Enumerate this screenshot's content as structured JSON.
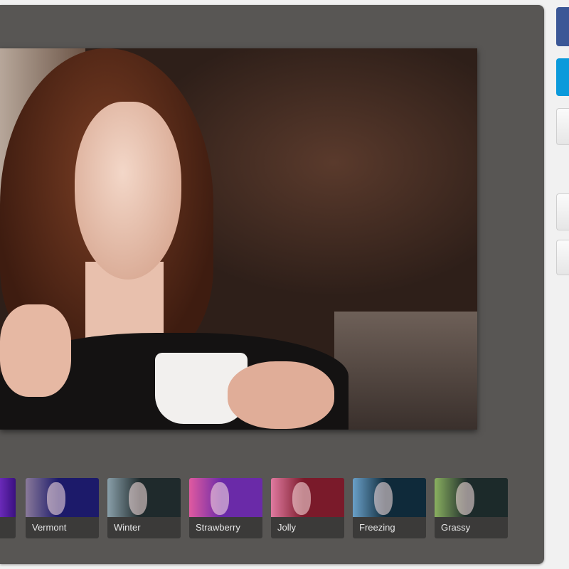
{
  "filters": [
    {
      "label": "",
      "color": "#4a1a9a"
    },
    {
      "label": "Vermont",
      "color": "#1c1a6a"
    },
    {
      "label": "Winter",
      "color": "#1f2a2c"
    },
    {
      "label": "Strawberry",
      "color": "#6a2aa8"
    },
    {
      "label": "Jolly",
      "color": "#7a1a2a"
    },
    {
      "label": "Freezing",
      "color": "#0f2a3a"
    },
    {
      "label": "Grassy",
      "color": "#1c2a2a"
    }
  ],
  "share": {
    "facebook_color": "#3b5796",
    "twitter_color": "#0b9adb"
  }
}
